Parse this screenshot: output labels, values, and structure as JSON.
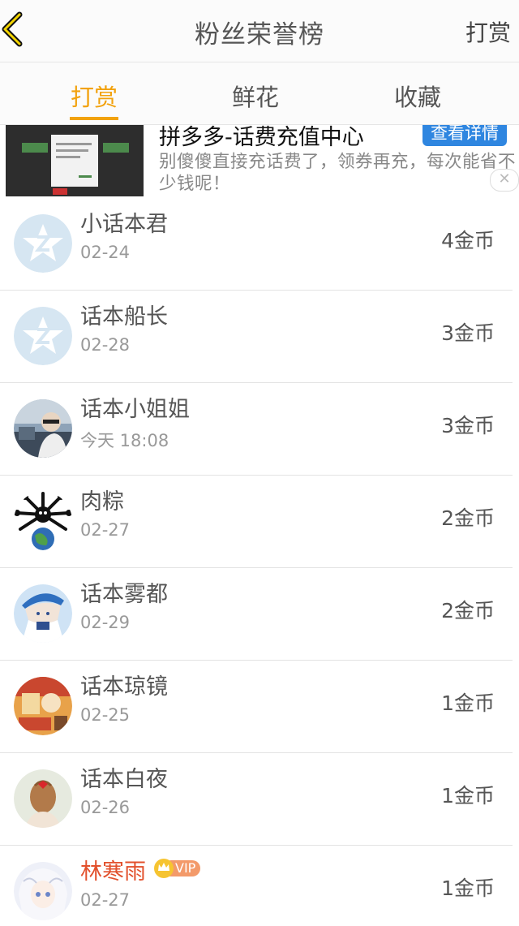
{
  "header": {
    "title": "粉丝荣誉榜",
    "action_label": "打赏"
  },
  "tabs": [
    {
      "label": "打赏",
      "active": true
    },
    {
      "label": "鲜花",
      "active": false
    },
    {
      "label": "收藏",
      "active": false
    }
  ],
  "ad": {
    "title": "拼多多-话费充值中心",
    "detail_label": "查看详情",
    "description": "别傻傻直接充话费了，领券再充，每次能省不少钱呢！"
  },
  "list": [
    {
      "name": "小话本君",
      "date": "02-24",
      "coins": "4金币",
      "avatar": "default-star-icon"
    },
    {
      "name": "话本船长",
      "date": "02-28",
      "coins": "3金币",
      "avatar": "default-star-icon"
    },
    {
      "name": "话本小姐姐",
      "date": "今天 18:08",
      "coins": "3金币",
      "avatar": "photo-avatar"
    },
    {
      "name": "肉粽",
      "date": "02-27",
      "coins": "2金币",
      "avatar": "spider-earth-avatar"
    },
    {
      "name": "话本雾都",
      "date": "02-29",
      "coins": "2金币",
      "avatar": "anime-blue-avatar"
    },
    {
      "name": "话本琼镜",
      "date": "02-25",
      "coins": "1金币",
      "avatar": "cartoon-orange-avatar"
    },
    {
      "name": "话本白夜",
      "date": "02-26",
      "coins": "1金币",
      "avatar": "girl-back-avatar"
    },
    {
      "name": "林寒雨",
      "date": "02-27",
      "coins": "1金币",
      "avatar": "anime-white-avatar",
      "vip": true,
      "vip_label": "VIP"
    }
  ],
  "colors": {
    "accent": "#f2a20e",
    "vip_name": "#e2502c",
    "ad_button": "#2f86e0"
  }
}
